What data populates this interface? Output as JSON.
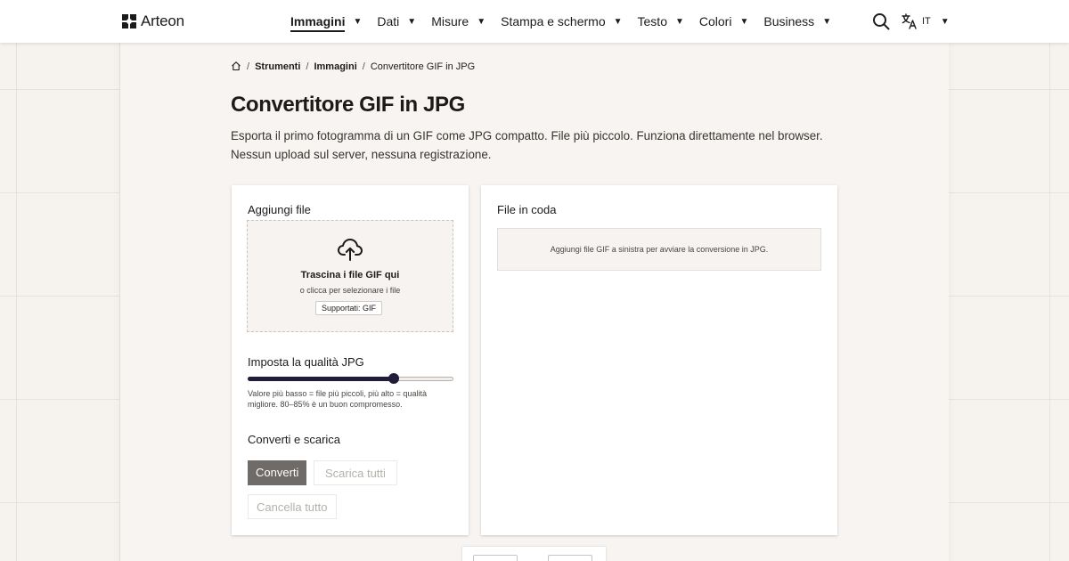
{
  "app": {
    "logo_text": "Arteon",
    "language": "IT"
  },
  "nav": {
    "items": [
      {
        "label": "Immagini",
        "active": true
      },
      {
        "label": "Dati"
      },
      {
        "label": "Misure"
      },
      {
        "label": "Stampa e schermo"
      },
      {
        "label": "Testo"
      },
      {
        "label": "Colori"
      },
      {
        "label": "Business"
      }
    ],
    "caret": "▼"
  },
  "breadcrumb": {
    "items": [
      "Strumenti",
      "Immagini",
      "Convertitore GIF in JPG"
    ],
    "separator": "/"
  },
  "page": {
    "title": "Convertitore GIF in JPG",
    "description": "Esporta il primo fotogramma di un GIF come JPG compatto. File più piccolo. Funziona direttamente nel browser. Nessun upload sul server, nessuna registrazione."
  },
  "upload": {
    "section_title": "Aggiungi file",
    "drop_title": "Trascina i file GIF qui",
    "drop_subtitle": "o clicca per selezionare i file",
    "supported_badge": "Supportati: GIF"
  },
  "quality": {
    "section_title": "Imposta la qualità JPG",
    "value_fraction": 0.71,
    "hint": "Valore più basso = file più piccoli, più alto = qualità migliore. 80–85% è un buon compromesso."
  },
  "actions": {
    "section_title": "Converti e scarica",
    "convert_label": "Converti",
    "download_all_label": "Scarica tutti",
    "clear_all_label": "Cancella tutto"
  },
  "queue": {
    "title": "File in coda",
    "empty_message": "Aggiungi file GIF a sinistra per avviare la conversione in JPG."
  },
  "colors": {
    "accent": "#201c3a",
    "primary_button": "#6f6b69",
    "background": "#f6f2ee"
  },
  "icons": {
    "logo": "arteon-logo-icon",
    "search": "search-icon",
    "language": "translate-icon",
    "home": "home-icon",
    "upload": "cloud-upload-icon"
  }
}
